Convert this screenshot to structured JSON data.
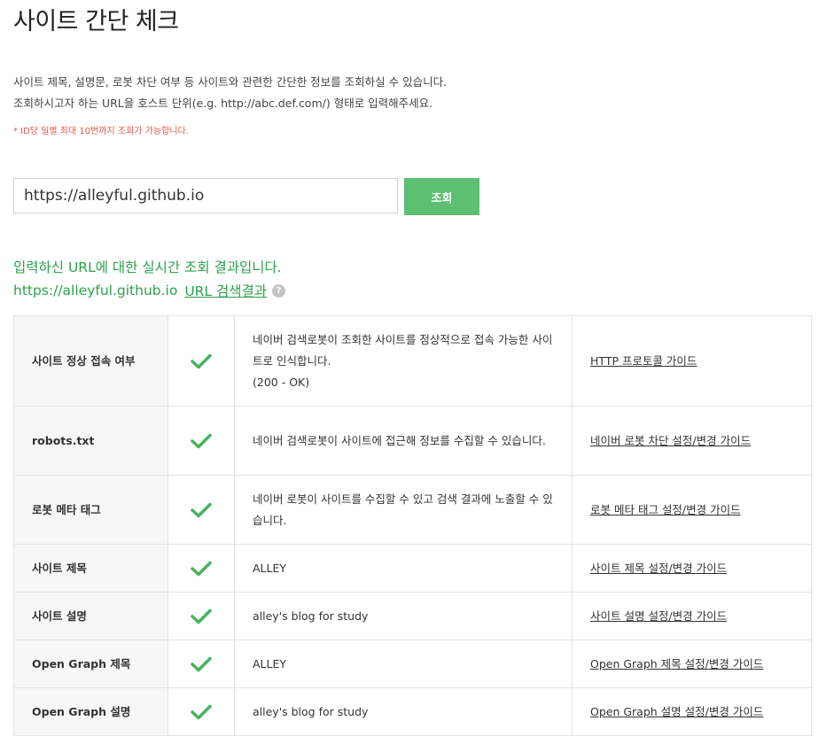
{
  "title": "사이트 간단 체크",
  "description": [
    "사이트 제목, 설명문, 로봇 차단 여부 등 사이트와 관련한 간단한 정보를 조회하실 수 있습니다.",
    "조회하시고자 하는 URL을 호스트 단위(e.g. http://abc.def.com/) 형태로 입력해주세요."
  ],
  "notice": "* ID당 일별 최대 10번까지 조회가 가능합니다.",
  "search": {
    "value": "https://alleyful.github.io",
    "button_label": "조회"
  },
  "result": {
    "heading": "입력하신 URL에 대한 실시간 조회 결과입니다.",
    "url": "https://alleyful.github.io",
    "search_link": "URL 검색결과",
    "help_icon": "?"
  },
  "accent_color": "#5cbf72",
  "rows": [
    {
      "name": "사이트 정상 접속 여부",
      "status": "check-icon",
      "info": "네이버 검색로봇이 조회한 사이트를 정상적으로 접속 가능한 사이트로 인식합니다.",
      "info2": "(200 - OK)",
      "guide": "HTTP 프로토콜 가이드"
    },
    {
      "name": "robots.txt",
      "status": "check-icon",
      "info": "네이버 검색로봇이 사이트에 접근해 정보를 수집할 수 있습니다.",
      "guide": "네이버 로봇 차단 설정/변경 가이드"
    },
    {
      "name": "로봇 메타 태그",
      "status": "check-icon",
      "info": "네이버 로봇이 사이트를 수집할 수 있고 검색 결과에 노출할 수 있습니다.",
      "guide": "로봇 메타 태그 설정/변경 가이드"
    },
    {
      "name": "사이트 제목",
      "status": "check-icon",
      "info": "ALLEY",
      "guide": "사이트 제목 설정/변경 가이드"
    },
    {
      "name": "사이트 설명",
      "status": "check-icon",
      "info": "alley's blog for study",
      "guide": "사이트 설명 설정/변경 가이드"
    },
    {
      "name": "Open Graph 제목",
      "status": "check-icon",
      "info": "ALLEY",
      "guide": "Open Graph 제목 설정/변경 가이드"
    },
    {
      "name": "Open Graph 설명",
      "status": "check-icon",
      "info": "alley's blog for study",
      "guide": "Open Graph 설명 설정/변경 가이드"
    }
  ]
}
